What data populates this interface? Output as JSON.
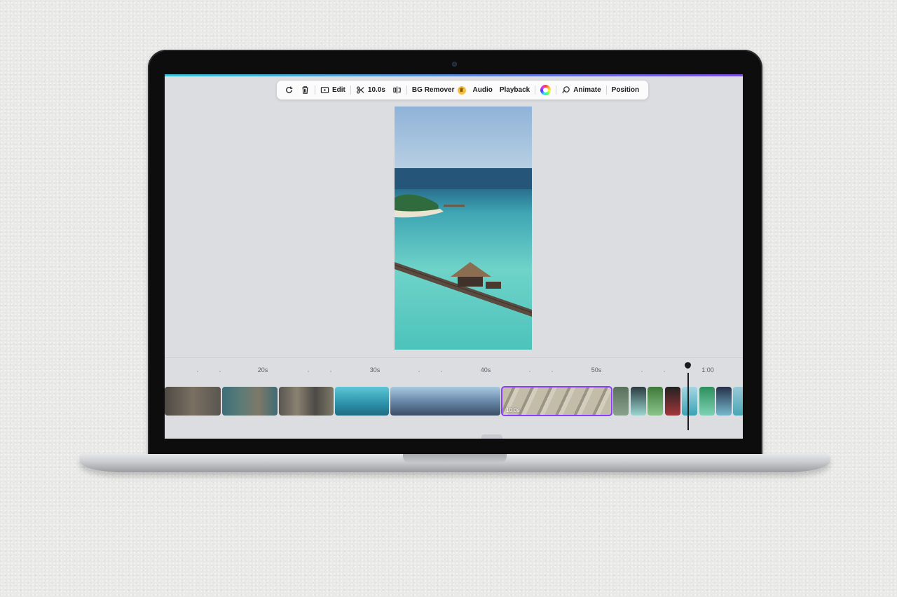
{
  "toolbar": {
    "edit_label": "Edit",
    "duration_label": "10.0s",
    "bg_remover_label": "BG Remover",
    "audio_label": "Audio",
    "playback_label": "Playback",
    "animate_label": "Animate",
    "position_label": "Position"
  },
  "timeline": {
    "ticks": [
      "20s",
      "30s",
      "40s",
      "50s",
      "1:00"
    ],
    "selected_clip_duration": "10.0s",
    "playhead_time_fraction": 0.9
  },
  "colors": {
    "accent_start": "#39c3d6",
    "accent_end": "#7c4ee4",
    "selection": "#8b3dff"
  },
  "icons": [
    "replace-icon",
    "trash-icon",
    "play-edit-icon",
    "scissors-icon",
    "flip-icon",
    "crown-icon",
    "color-wheel-icon",
    "animate-icon"
  ]
}
